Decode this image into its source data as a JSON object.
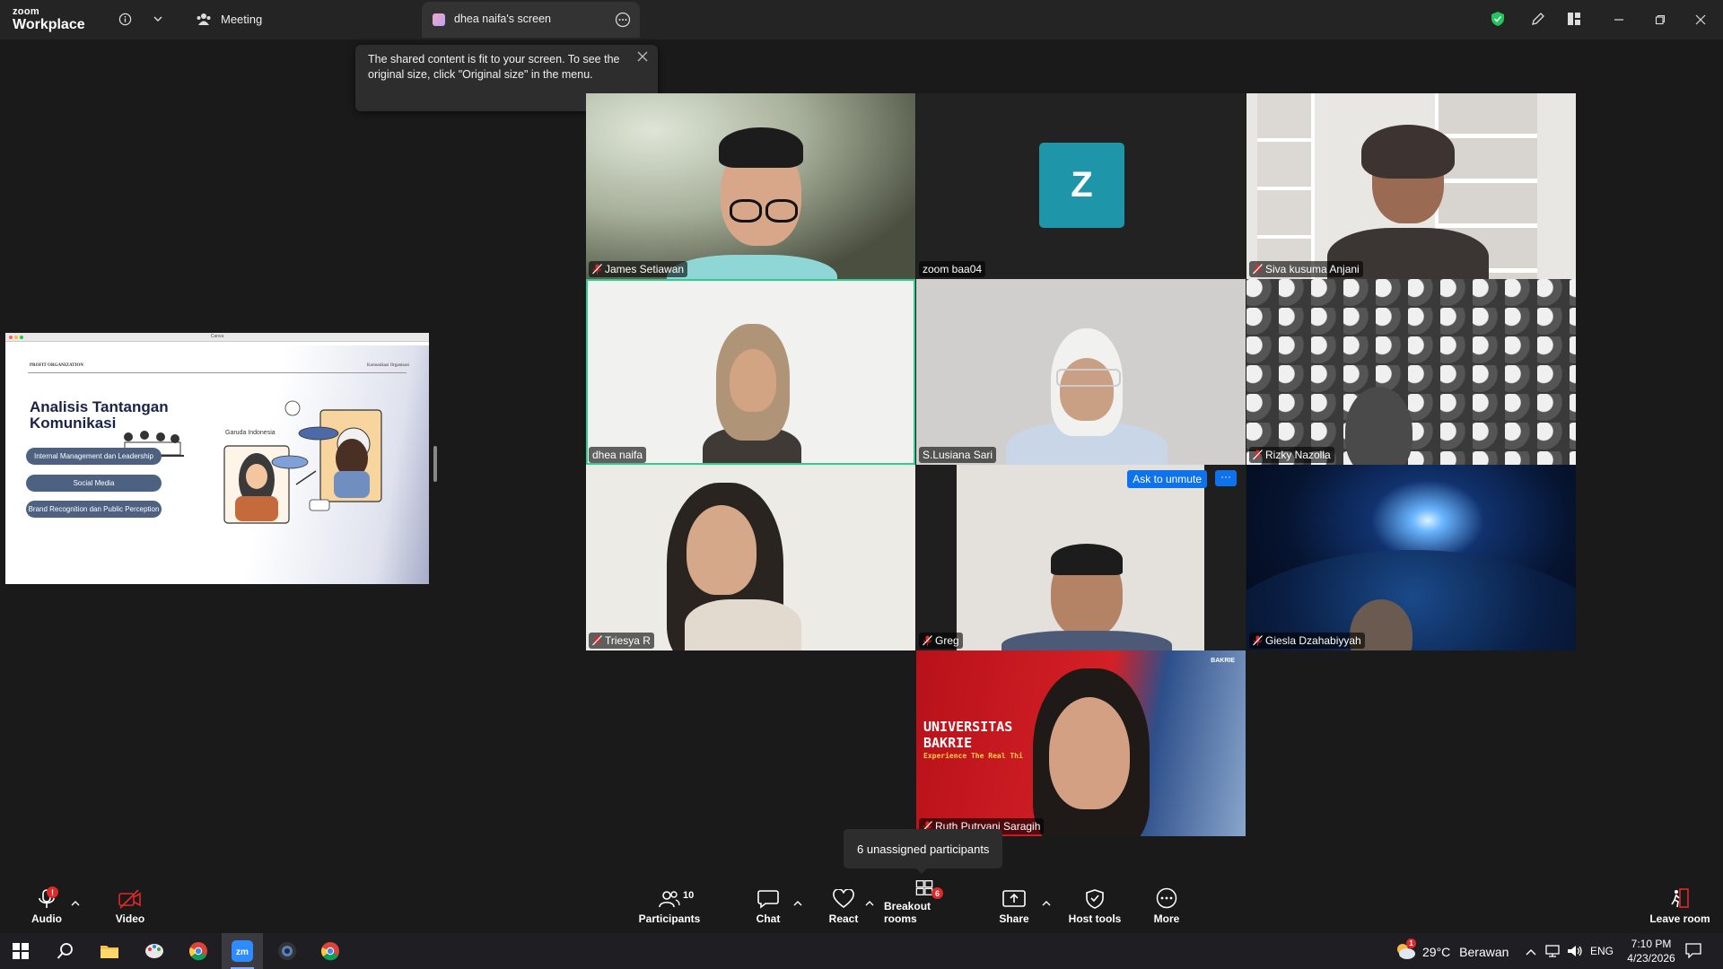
{
  "app": {
    "logo_top": "zoom",
    "logo_bottom": "Workplace"
  },
  "titlebar": {
    "meeting_label": "Meeting",
    "tab_label": "dhea naifa's screen"
  },
  "tooltip": {
    "text": "The shared content is fit to your screen. To see the original size, click \"Original size\" in the menu."
  },
  "slide": {
    "window_title": "Canva",
    "top_left_label": "PROFIT ORGANIZATION",
    "top_right_label": "Komunikasi Organisasi",
    "title_line1": "Analisis Tantangan",
    "title_line2": "Komunikasi",
    "pills": [
      "Internal Management dan Leadership",
      "Social Media",
      "Brand Recognition dan Public Perception"
    ],
    "garuda_label": "Garuda Indonesia"
  },
  "participants": [
    {
      "name": "James Setiawan",
      "muted": true
    },
    {
      "name": "zoom baa04",
      "muted": false,
      "avatar": "Z"
    },
    {
      "name": "Siva kusuma Anjani",
      "muted": true
    },
    {
      "name": "dhea naifa",
      "muted": false,
      "active": true
    },
    {
      "name": "S.Lusiana Sari",
      "muted": false
    },
    {
      "name": "Rizky Nazolla",
      "muted": true
    },
    {
      "name": "Triesya R",
      "muted": true
    },
    {
      "name": "Greg",
      "muted": true,
      "ask_unmute": "Ask to unmute",
      "more": "···"
    },
    {
      "name": "Giesla Dzahabiyyah",
      "muted": true
    },
    {
      "name": "Ruth Putryani Saragih",
      "muted": true
    }
  ],
  "ruth_bg": {
    "line1": "UNIVERSITAS",
    "line2": "BAKRIE",
    "line3": "Experience The Real Thi",
    "brand": "BAKRIE"
  },
  "unassigned": "6 unassigned participants",
  "toolbar": {
    "audio": "Audio",
    "video": "Video",
    "participants": "Participants",
    "participants_count": "10",
    "chat": "Chat",
    "react": "React",
    "breakout": "Breakout rooms",
    "breakout_badge": "6",
    "share": "Share",
    "host_tools": "Host tools",
    "more": "More",
    "leave": "Leave room"
  },
  "taskbar": {
    "weather_temp": "29°C",
    "weather_desc": "Berawan",
    "weather_badge": "1",
    "lang": "ENG",
    "time": "7:10 PM",
    "date": "4/23/2026"
  },
  "colors": {
    "accent_blue": "#0e72ed",
    "active_speaker": "#2ecc8f",
    "avatar_teal": "#1e95a8",
    "mute_red": "#e02828"
  }
}
